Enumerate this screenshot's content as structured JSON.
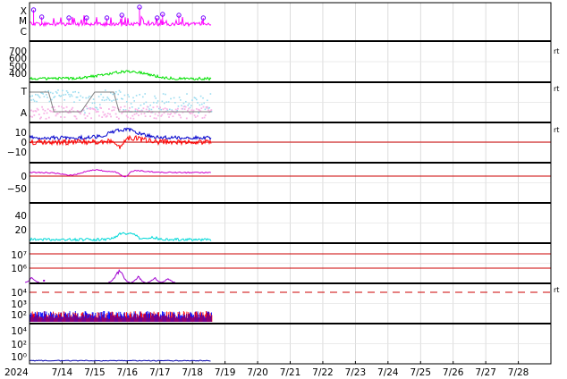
{
  "chart_data": {
    "type": "line",
    "x_axis": {
      "year_label": "2024",
      "ticks": [
        "7/14",
        "7/15",
        "7/16",
        "7/17",
        "7/18",
        "7/19",
        "7/20",
        "7/21",
        "7/22",
        "7/23",
        "7/24",
        "7/25",
        "7/26",
        "7/27",
        "7/28"
      ],
      "xlim": [
        "2024-07-13",
        "2024-07-28T23:59"
      ],
      "data_end": "2024-07-18T14:00",
      "grid": true
    },
    "side_marker": "rt",
    "panels": [
      {
        "id": "flare",
        "ytick_labels": [
          "X",
          "M",
          "C"
        ],
        "side_marker": false,
        "series": [
          {
            "color": "#ff00ff",
            "level_range": [
              "C",
              "M"
            ],
            "baseline": "C"
          }
        ],
        "markers": {
          "color": "#6a00ff",
          "x": [
            "2024-07-13T03:00",
            "2024-07-13T09:00",
            "2024-07-14T05:00",
            "2024-07-14T18:00",
            "2024-07-15T09:00",
            "2024-07-15T20:00",
            "2024-07-16T09:00",
            "2024-07-16T22:00",
            "2024-07-17T02:00",
            "2024-07-17T14:00",
            "2024-07-18T08:00"
          ]
        }
      },
      {
        "id": "speed",
        "ytick_labels": [
          "700",
          "600",
          "500",
          "400"
        ],
        "ylim": [
          300,
          750
        ],
        "side_marker": true,
        "series": [
          {
            "color": "#00e000",
            "base": 380,
            "range": [
              350,
              420
            ]
          }
        ]
      },
      {
        "id": "ta",
        "ytick_labels": [
          "T",
          "A"
        ],
        "side_marker": true,
        "series": [
          {
            "color": "#9adcf0",
            "level": "T"
          },
          {
            "color": "#f8b4e6",
            "level": "A"
          },
          {
            "color": "#808080",
            "type": "step"
          }
        ]
      },
      {
        "id": "bfield",
        "ytick_labels": [
          "10",
          "0",
          "−10"
        ],
        "ylim": [
          -16,
          16
        ],
        "side_marker": true,
        "reference_line": 0,
        "series": [
          {
            "color": "#0000cc",
            "base": 4
          },
          {
            "color": "#ff0000",
            "base": 0
          }
        ]
      },
      {
        "id": "dst",
        "ytick_labels": [
          "0",
          "−50"
        ],
        "ylim": [
          -75,
          20
        ],
        "side_marker": false,
        "reference_line": 0,
        "series": [
          {
            "color": "#cc00cc",
            "base": 2
          }
        ]
      },
      {
        "id": "kp",
        "ytick_labels": [
          "40",
          "20"
        ],
        "ylim": [
          0,
          55
        ],
        "side_marker": false,
        "series": [
          {
            "color": "#00d8d8",
            "base": 4
          }
        ]
      },
      {
        "id": "electron",
        "ytick_labels": [
          "10⁷",
          "10⁶"
        ],
        "side_marker": true,
        "reference_lines": [
          "10⁷",
          "10⁶"
        ],
        "series": [
          {
            "color": "#a000d0",
            "type": "bursts"
          }
        ]
      },
      {
        "id": "proton",
        "ytick_labels": [
          "10⁴",
          "10³",
          "10²"
        ],
        "side_marker": true,
        "reference_line_dashed": "10⁴",
        "series": [
          {
            "color": "#0000ff",
            "level": "10¹"
          },
          {
            "color": "#ff0000",
            "level": "10¹"
          }
        ]
      },
      {
        "id": "flux",
        "ytick_labels": [
          "10⁴",
          "10²",
          "10⁰"
        ],
        "side_marker": false,
        "series": [
          {
            "color": "#0000aa",
            "level": "10⁰"
          }
        ]
      }
    ]
  }
}
